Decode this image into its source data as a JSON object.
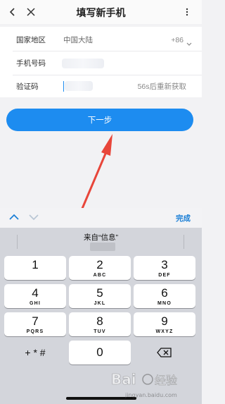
{
  "nav": {
    "title": "填写新手机"
  },
  "form": {
    "country_label": "国家地区",
    "country_value": "中国大陆",
    "country_code": "+86",
    "phone_label": "手机号码",
    "code_label": "验证码",
    "resend": "56s后重新获取"
  },
  "next_button": "下一步",
  "toolbar": {
    "done": "完成"
  },
  "keyboard": {
    "suggestion": "来自“信息”",
    "keys": [
      {
        "n": "1",
        "l": ""
      },
      {
        "n": "2",
        "l": "ABC"
      },
      {
        "n": "3",
        "l": "DEF"
      },
      {
        "n": "4",
        "l": "GHI"
      },
      {
        "n": "5",
        "l": "JKL"
      },
      {
        "n": "6",
        "l": "MNO"
      },
      {
        "n": "7",
        "l": "PQRS"
      },
      {
        "n": "8",
        "l": "TUV"
      },
      {
        "n": "9",
        "l": "WXYZ"
      }
    ],
    "symbols": "+ * #",
    "zero": "0"
  },
  "watermark": {
    "brand": "Bai",
    "brand2": "经验",
    "url": "jingyan.baidu.com"
  },
  "colors": {
    "accent": "#1d8cf0",
    "arrow": "#e8463a"
  }
}
